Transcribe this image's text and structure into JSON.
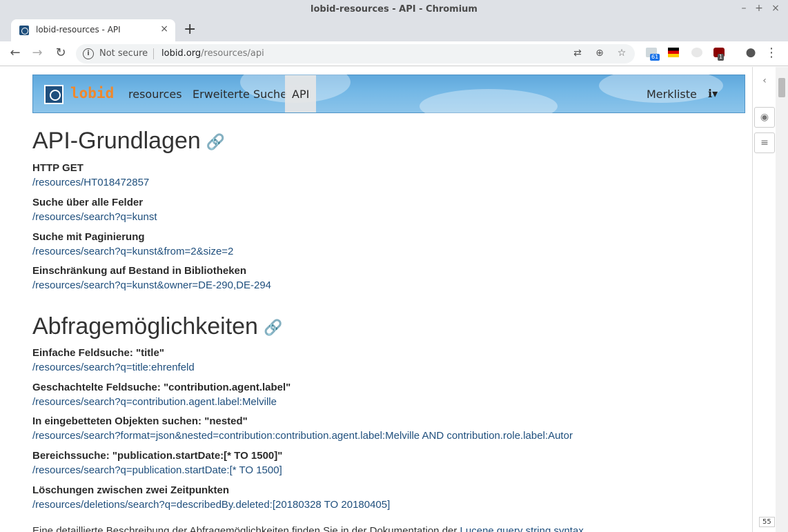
{
  "window": {
    "title": "lobid-resources - API - Chromium"
  },
  "tab": {
    "title": "lobid-resources - API",
    "close": "×",
    "new_tab": "+"
  },
  "omnibox": {
    "security": "Not secure",
    "domain": "lobid.org",
    "path": "/resources/api"
  },
  "extensions": {
    "badge1": "61",
    "badge2": "1"
  },
  "navbar": {
    "brand": "lobid",
    "items": [
      "resources",
      "Erweiterte Suche",
      "API"
    ],
    "merkliste": "Merkliste",
    "info_icon": "info-icon"
  },
  "section1": {
    "heading": "API-Grundlagen",
    "entries": [
      {
        "label": "HTTP GET",
        "link": "/resources/HT018472857"
      },
      {
        "label": "Suche über alle Felder",
        "link": "/resources/search?q=kunst"
      },
      {
        "label": "Suche mit Paginierung",
        "link": "/resources/search?q=kunst&from=2&size=2"
      },
      {
        "label": "Einschränkung auf Bestand in Bibliotheken",
        "link": "/resources/search?q=kunst&owner=DE-290,DE-294"
      }
    ]
  },
  "section2": {
    "heading": "Abfragemöglichkeiten",
    "entries": [
      {
        "label": "Einfache Feldsuche: \"title\"",
        "link": "/resources/search?q=title:ehrenfeld"
      },
      {
        "label": "Geschachtelte Feldsuche: \"contribution.agent.label\"",
        "link": "/resources/search?q=contribution.agent.label:Melville"
      },
      {
        "label": "In eingebetteten Objekten suchen: \"nested\"",
        "link": "/resources/search?format=json&nested=contribution:contribution.agent.label:Melville AND contribution.role.label:Autor"
      },
      {
        "label": "Bereichssuche: \"publication.startDate:[* TO 1500]\"",
        "link": "/resources/search?q=publication.startDate:[* TO 1500]"
      },
      {
        "label": "Löschungen zwischen zwei Zeitpunkten",
        "link": "/resources/deletions/search?q=describedBy.deleted:[20180328 TO 20180405]"
      }
    ]
  },
  "footnote": {
    "text": "Eine detaillierte Beschreibung der Abfragemöglichkeiten finden Sie in der Dokumentation der ",
    "link": "Lucene query string syntax"
  },
  "page_badge": "55"
}
